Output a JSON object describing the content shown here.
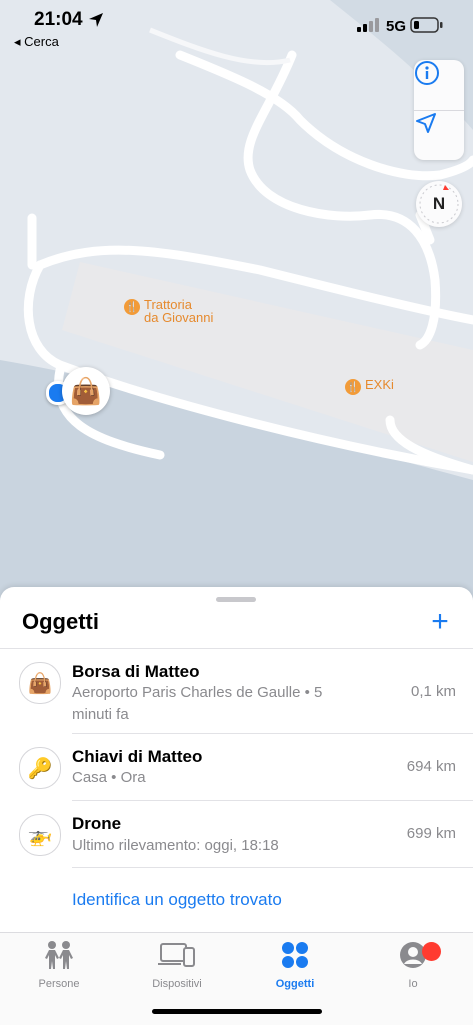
{
  "status_bar": {
    "time": "21:04",
    "back_app": "◂ Cerca",
    "network": "5G"
  },
  "map": {
    "pois": [
      {
        "label": "Trattoria\nda Giovanni"
      },
      {
        "label": "EXKi"
      }
    ],
    "compass_label": "N",
    "controls": [
      "info-icon",
      "location-arrow-icon"
    ]
  },
  "sheet": {
    "title": "Oggetti",
    "add_label": "+",
    "items": [
      {
        "icon": "👜",
        "name": "Borsa di Matteo",
        "subtitle": "Aeroporto Paris Charles de Gaulle • 5 minuti fa",
        "distance": "0,1 km"
      },
      {
        "icon": "🔑",
        "name": "Chiavi di Matteo",
        "subtitle": "Casa • Ora",
        "distance": "694 km"
      },
      {
        "icon": "🚁",
        "name": "Drone",
        "subtitle": "Ultimo rilevamento: oggi, 18:18",
        "distance": "699 km"
      }
    ],
    "identify_link": "Identifica un oggetto trovato"
  },
  "tabs": [
    {
      "label": "Persone",
      "active": false
    },
    {
      "label": "Dispositivi",
      "active": false
    },
    {
      "label": "Oggetti",
      "active": true
    },
    {
      "label": "Io",
      "active": false
    }
  ],
  "colors": {
    "accent": "#1a7bf0",
    "badge": "#ff3b30",
    "poi": "#f29b38"
  }
}
